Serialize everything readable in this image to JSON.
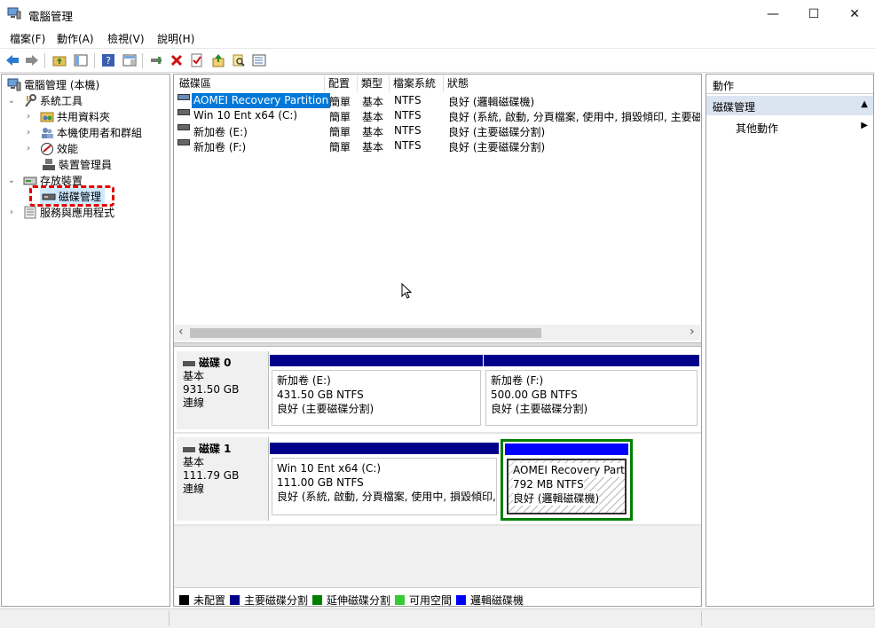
{
  "window": {
    "title": "電腦管理",
    "minimize_glyph": "—",
    "maximize_glyph": "☐",
    "close_glyph": "✕"
  },
  "menu": [
    {
      "label": "檔案(F)"
    },
    {
      "label": "動作(A)"
    },
    {
      "label": "檢視(V)"
    },
    {
      "label": "說明(H)"
    }
  ],
  "toolbar": {
    "icons": [
      "back-arrow-icon",
      "forward-arrow-icon",
      "up-folder-icon",
      "show-hide-tree-icon",
      "help-icon",
      "properties-pane-icon",
      "connect-icon",
      "delete-icon",
      "check-icon",
      "export-icon",
      "search-icon",
      "list-icon"
    ]
  },
  "tree": {
    "root": "電腦管理 (本機)",
    "system_tools": "系統工具",
    "shared_folders": "共用資料夾",
    "local_users": "本機使用者和群組",
    "performance": "效能",
    "device_manager": "裝置管理員",
    "storage": "存放裝置",
    "disk_management": "磁碟管理",
    "services": "服務與應用程式"
  },
  "volume_list": {
    "headers": [
      "磁碟區",
      "配置",
      "類型",
      "檔案系統",
      "狀態"
    ],
    "rows": [
      {
        "name": "AOMEI Recovery Partition",
        "layout": "簡單",
        "type": "基本",
        "fs": "NTFS",
        "status": "良好 (邏輯磁碟機)",
        "selected": true
      },
      {
        "name": "Win 10 Ent x64 (C:)",
        "layout": "簡單",
        "type": "基本",
        "fs": "NTFS",
        "status": "良好 (系統, 啟動, 分頁檔案, 使用中, 損毀傾印, 主要磁碟",
        "selected": false
      },
      {
        "name": "新加卷 (E:)",
        "layout": "簡單",
        "type": "基本",
        "fs": "NTFS",
        "status": "良好 (主要磁碟分割)",
        "selected": false
      },
      {
        "name": "新加卷 (F:)",
        "layout": "簡單",
        "type": "基本",
        "fs": "NTFS",
        "status": "良好 (主要磁碟分割)",
        "selected": false
      }
    ],
    "scroll_left": "‹",
    "scroll_right": "›"
  },
  "disks": [
    {
      "name": "磁碟 0",
      "type": "基本",
      "size": "931.50 GB",
      "state": "連線",
      "partitions": [
        {
          "name": "新加卷 (E:)",
          "size": "431.50 GB NTFS",
          "status": "良好 (主要磁碟分割)",
          "bar_color": "#00008b"
        },
        {
          "name": "新加卷 (F:)",
          "size": "500.00 GB NTFS",
          "status": "良好 (主要磁碟分割)",
          "bar_color": "#00008b"
        }
      ]
    },
    {
      "name": "磁碟 1",
      "type": "基本",
      "size": "111.79 GB",
      "state": "連線",
      "partitions": [
        {
          "name": "Win 10 Ent x64  (C:)",
          "size": "111.00 GB NTFS",
          "status": "良好 (系統, 啟動, 分頁檔案, 使用中, 損毀傾印, 主",
          "bar_color": "#00008b"
        },
        {
          "name": "AOMEI Recovery Part",
          "size": "792 MB NTFS",
          "status": "良好 (邏輯磁碟機)",
          "bar_color": "#0000ff"
        }
      ]
    }
  ],
  "legend": [
    {
      "label": "未配置",
      "color": "#000000"
    },
    {
      "label": "主要磁碟分割",
      "color": "#00008b"
    },
    {
      "label": "延伸磁碟分割",
      "color": "#008000"
    },
    {
      "label": "可用空間",
      "color": "#33cc33"
    },
    {
      "label": "邏輯磁碟機",
      "color": "#0000ff"
    }
  ],
  "actions": {
    "title": "動作",
    "section": "磁碟管理",
    "section_arrow": "▲",
    "more": "其他動作",
    "more_arrow": "▶"
  },
  "colors": {
    "selection": "#0078d7",
    "highlight_dash": "#e00000",
    "extended_border": "#008000"
  }
}
